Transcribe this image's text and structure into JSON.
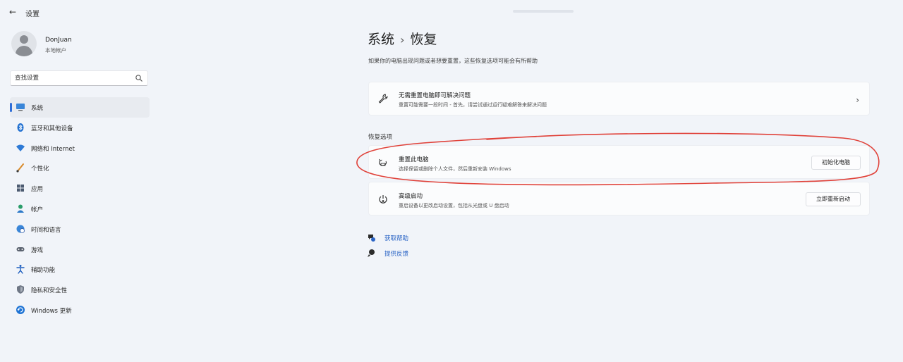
{
  "window": {
    "title": "设置",
    "back_icon": "back-arrow-icon"
  },
  "user": {
    "name": "DonJuan",
    "account_type": "本地帐户"
  },
  "search": {
    "placeholder": "查找设置",
    "icon": "search-icon"
  },
  "sidebar": {
    "items": [
      {
        "label": "系统",
        "icon": "system-icon",
        "active": true
      },
      {
        "label": "蓝牙和其他设备",
        "icon": "bluetooth-icon"
      },
      {
        "label": "网络和 Internet",
        "icon": "wifi-icon"
      },
      {
        "label": "个性化",
        "icon": "brush-icon"
      },
      {
        "label": "应用",
        "icon": "apps-icon"
      },
      {
        "label": "帐户",
        "icon": "account-icon"
      },
      {
        "label": "时间和语言",
        "icon": "globe-clock-icon"
      },
      {
        "label": "游戏",
        "icon": "gamepad-icon"
      },
      {
        "label": "辅助功能",
        "icon": "accessibility-icon"
      },
      {
        "label": "隐私和安全性",
        "icon": "shield-icon"
      },
      {
        "label": "Windows 更新",
        "icon": "update-icon"
      }
    ]
  },
  "main": {
    "breadcrumb_parent": "系统",
    "breadcrumb_separator": "›",
    "page_title": "恢复",
    "description": "如果你的电脑出现问题或者想要重置，这些恢复选项可能会有所帮助",
    "troubleshoot_card": {
      "title": "无需重置电脑即可解决问题",
      "subtitle": "重置可能需要一段时间 - 首先，请尝试通过运行疑难解答来解决问题",
      "icon": "wrench-icon"
    },
    "section_label": "恢复选项",
    "reset_card": {
      "title": "重置此电脑",
      "subtitle": "选择保留或删除个人文件，然后重新安装 Windows",
      "button": "初始化电脑",
      "icon": "reset-pc-icon"
    },
    "advanced_card": {
      "title": "高级启动",
      "subtitle": "重启设备以更改启动设置，包括从光盘或 U 盘启动",
      "button": "立即重新启动",
      "icon": "restart-icon"
    },
    "links": [
      {
        "label": "获取帮助",
        "icon": "help-icon"
      },
      {
        "label": "提供反馈",
        "icon": "feedback-icon"
      }
    ]
  },
  "annotation": {
    "color": "#e0423a",
    "shape": "hand-drawn-ellipse"
  },
  "colors": {
    "accent": "#2f6ed8",
    "link": "#2a64c5",
    "background": "#f1f4f9"
  }
}
